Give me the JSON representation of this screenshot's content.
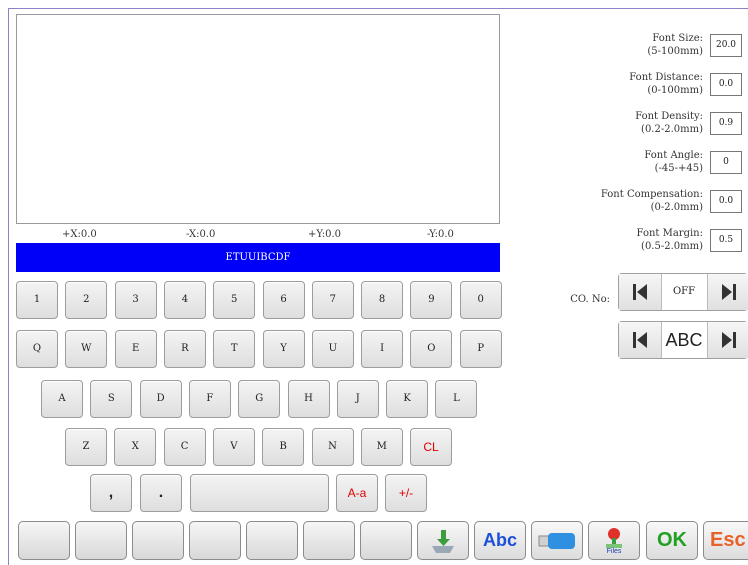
{
  "coords": {
    "px": "+X:0.0",
    "nx": "-X:0.0",
    "py": "+Y:0.0",
    "ny": "-Y:0.0"
  },
  "text_field": "ETUUIBCDF",
  "keyboard": {
    "row1": [
      "1",
      "2",
      "3",
      "4",
      "5",
      "6",
      "7",
      "8",
      "9",
      "0"
    ],
    "row2": [
      "Q",
      "W",
      "E",
      "R",
      "T",
      "Y",
      "U",
      "I",
      "O",
      "P"
    ],
    "row3": [
      "A",
      "S",
      "D",
      "F",
      "G",
      "H",
      "J",
      "K",
      "L"
    ],
    "row4": [
      "Z",
      "X",
      "C",
      "V",
      "B",
      "N",
      "M"
    ],
    "clear": "CL",
    "comma": ",",
    "period": ".",
    "case": "A-a",
    "sign": "+/-"
  },
  "params": [
    {
      "label": "Font Size:",
      "range": "(5-100mm)",
      "value": "20.0"
    },
    {
      "label": "Font Distance:",
      "range": "(0-100mm)",
      "value": "0.0"
    },
    {
      "label": "Font Density:",
      "range": "(0.2-2.0mm)",
      "value": "0.9"
    },
    {
      "label": "Font Angle:",
      "range": "(-45-+45)",
      "value": "0"
    },
    {
      "label": "Font Compensation:",
      "range": "(0-2.0mm)",
      "value": "0.0"
    },
    {
      "label": "Font Margin:",
      "range": "(0.5-2.0mm)",
      "value": "0.5"
    }
  ],
  "co_no": {
    "label": "CO. No:",
    "value": "OFF"
  },
  "font_selector": {
    "value": "ABC"
  },
  "bottom": {
    "abc": "Abc",
    "files": "Files",
    "ok": "OK",
    "esc": "Esc"
  },
  "colors": {
    "accent_blue": "#0000f8",
    "ok_green": "#2e9e2e",
    "esc_orange": "#e06a2c",
    "red_text": "#e00000"
  }
}
